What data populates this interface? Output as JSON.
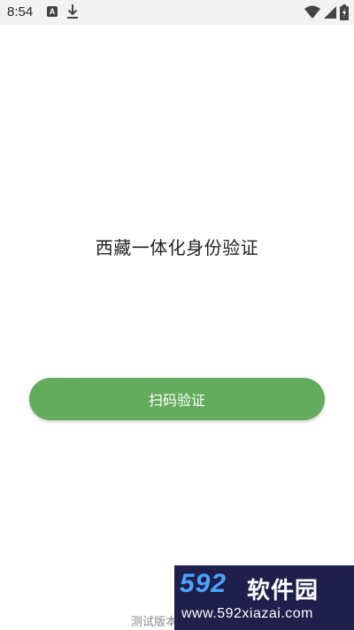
{
  "status_bar": {
    "time": "8:54",
    "notification_a": "A",
    "icons": [
      "a-notification-icon",
      "download-icon",
      "wifi-icon",
      "signal-icon",
      "battery-icon"
    ]
  },
  "main": {
    "title": "西藏一体化身份验证",
    "scan_button_label": "扫码验证",
    "version_text": "测试版本"
  },
  "colors": {
    "button_bg": "#64ab5e",
    "button_text": "#ffffff",
    "title_text": "#222222",
    "status_bar_bg": "#f2f2f2"
  },
  "watermark": {
    "logo": "592",
    "brand": "软件园",
    "url": "www.592xiazai.com"
  }
}
